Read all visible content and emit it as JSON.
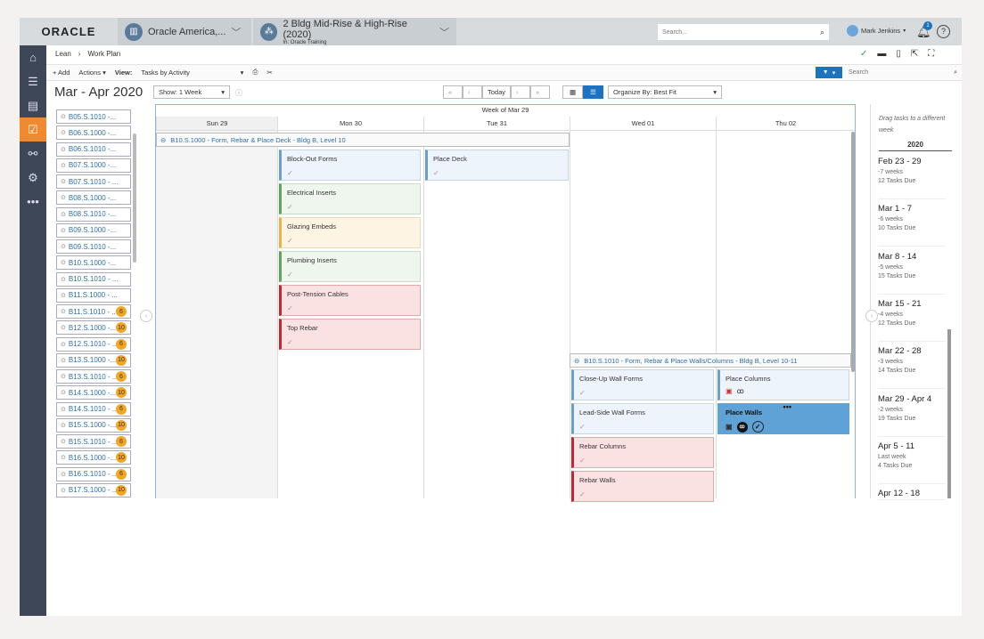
{
  "header": {
    "logo": "ORACLE",
    "company": "Oracle America,...",
    "project": "2 Bldg Mid-Rise & High-Rise (2020)",
    "project_sub": "In: Oracle Training",
    "search_placeholder": "Search...",
    "user": "Mark Jenkins",
    "notifications": "1"
  },
  "breadcrumb": [
    "Lean",
    "Work Plan"
  ],
  "toolbar": {
    "add": "+ Add",
    "actions": "Actions",
    "view_label": "View:",
    "view_value": "Tasks by Activity",
    "search_placeholder": "Search"
  },
  "calendar": {
    "title": "Mar - Apr 2020",
    "show": "Show: 1 Week",
    "today": "Today",
    "organize": "Organize By: Best Fit",
    "week_label": "Week of Mar 29",
    "days": [
      "Sun 29",
      "Mon 30",
      "Tue 31",
      "Wed 01",
      "Thu 02"
    ]
  },
  "activities": [
    {
      "label": "B05.S.1010 -..."
    },
    {
      "label": "B06.S.1000 -..."
    },
    {
      "label": "B06.S.1010 -..."
    },
    {
      "label": "B07.S.1000 -..."
    },
    {
      "label": "B07.S.1010 - ..."
    },
    {
      "label": "B08.S.1000 -..."
    },
    {
      "label": "B08.S.1010 -..."
    },
    {
      "label": "B09.S.1000 -..."
    },
    {
      "label": "B09.S.1010 -..."
    },
    {
      "label": "B10.S.1000 -..."
    },
    {
      "label": "B10.S.1010 - ..."
    },
    {
      "label": "B11.S.1000 - ..."
    },
    {
      "label": "B11.S.1010 - ...",
      "badge": "6"
    },
    {
      "label": "B12.S.1000 -...",
      "badge": "10"
    },
    {
      "label": "B12.S.1010 - ...",
      "badge": "6"
    },
    {
      "label": "B13.S.1000 -...",
      "badge": "10"
    },
    {
      "label": "B13.S.1010 - ...",
      "badge": "6"
    },
    {
      "label": "B14.S.1000 -...",
      "badge": "10"
    },
    {
      "label": "B14.S.1010 - ...",
      "badge": "6"
    },
    {
      "label": "B15.S.1000 -...",
      "badge": "10"
    },
    {
      "label": "B15.S.1010 - ...",
      "badge": "6"
    },
    {
      "label": "B16.S.1000 -...",
      "badge": "10"
    },
    {
      "label": "B16.S.1010 - ...",
      "badge": "6"
    },
    {
      "label": "B17.S.1000 - ...",
      "badge": "10"
    }
  ],
  "groups": {
    "g1": "B10.S.1000 - Form, Rebar & Place Deck - Bldg B, Level 10",
    "g2": "B10.S.1010 - Form, Rebar & Place Walls/Columns - Bldg B, Level 10-11"
  },
  "tasks": {
    "mon": [
      {
        "name": "Block-Out Forms",
        "color": "blue"
      },
      {
        "name": "Electrical Inserts",
        "color": "green"
      },
      {
        "name": "Glazing Embeds",
        "color": "yellow"
      },
      {
        "name": "Plumbing Inserts",
        "color": "green"
      },
      {
        "name": "Post-Tension Cables",
        "color": "red"
      },
      {
        "name": "Top Rebar",
        "color": "red"
      }
    ],
    "tue": [
      {
        "name": "Place Deck",
        "color": "blue"
      }
    ],
    "wed": [
      {
        "name": "Close-Up Wall Forms",
        "color": "blue"
      },
      {
        "name": "Lead-Side Wall Forms",
        "color": "blue"
      },
      {
        "name": "Rebar Columns",
        "color": "red"
      },
      {
        "name": "Rebar Walls",
        "color": "red"
      }
    ],
    "thu": [
      {
        "name": "Place Columns",
        "color": "blue"
      },
      {
        "name": "Place Walls",
        "color": "selected"
      }
    ]
  },
  "weeks_panel": {
    "hint": "Drag tasks to a different week",
    "year": "2020",
    "weeks": [
      {
        "range": "Feb 23 - 29",
        "rel": "-7 weeks",
        "due": "12 Tasks Due"
      },
      {
        "range": "Mar 1 - 7",
        "rel": "-6 weeks",
        "due": "10 Tasks Due"
      },
      {
        "range": "Mar 8 - 14",
        "rel": "-5 weeks",
        "due": "15 Tasks Due"
      },
      {
        "range": "Mar 15 - 21",
        "rel": "-4 weeks",
        "due": "12 Tasks Due"
      },
      {
        "range": "Mar 22 - 28",
        "rel": "-3 weeks",
        "due": "14 Tasks Due"
      },
      {
        "range": "Mar 29 - Apr 4",
        "rel": "-2 weeks",
        "due": "19 Tasks Due"
      },
      {
        "range": "Apr 5 - 11",
        "rel": "Last week",
        "due": "4 Tasks Due"
      },
      {
        "range": "Apr 12 - 18",
        "rel": "",
        "due": ""
      }
    ]
  },
  "colors": {
    "accent": "#f08a30",
    "primary": "#1e73be",
    "sidebar": "#3d4758",
    "selected_card": "#5fa3d6"
  }
}
